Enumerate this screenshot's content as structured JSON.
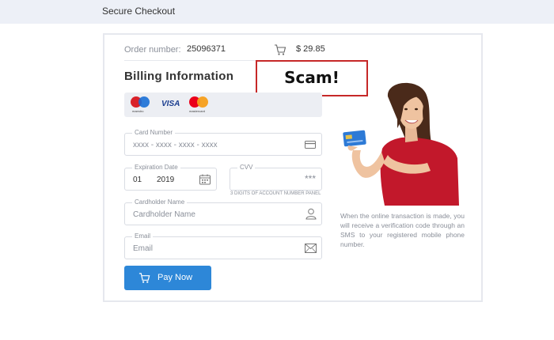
{
  "header": {
    "title": "Secure Checkout"
  },
  "order": {
    "label": "Order number:",
    "number": "25096371",
    "price": "$ 29.85"
  },
  "billing": {
    "title": "Billing Information"
  },
  "annotation": {
    "text": "Scam!",
    "color": "#c62828"
  },
  "brands": {
    "maestro": "maestro",
    "visa": "VISA",
    "mastercard": "mastercard"
  },
  "fields": {
    "card_number": {
      "label": "Card Number",
      "placeholder": "xxxx - xxxx - xxxx - xxxx",
      "icon": "credit-card-icon"
    },
    "expiration": {
      "label": "Expiration Date",
      "month": "01",
      "year": "2019",
      "icon": "calendar-icon"
    },
    "cvv": {
      "label": "CVV",
      "placeholder": "***",
      "note": "3 DIGITS OF ACCOUNT NUMBER PANEL"
    },
    "cardholder": {
      "label": "Cardholder Name",
      "placeholder": "Cardholder Name",
      "icon": "user-icon"
    },
    "email": {
      "label": "Email",
      "placeholder": "Email",
      "icon": "envelope-icon"
    }
  },
  "pay_button": {
    "label": "Pay Now",
    "color": "#2d87d8",
    "icon": "cart-icon"
  },
  "side_note": "When the online transaction is made, you will receive a verification code through an SMS to your registered mobile phone number."
}
